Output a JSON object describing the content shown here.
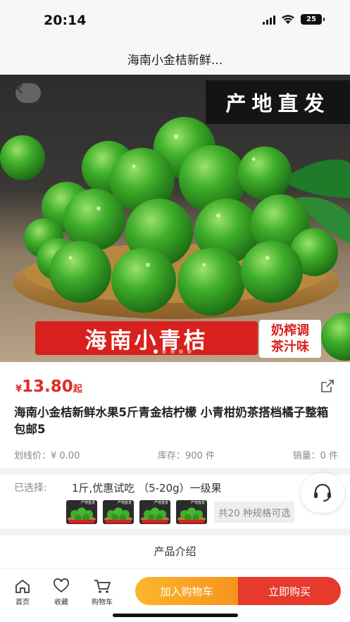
{
  "status_bar": {
    "time": "20:14",
    "battery": "25"
  },
  "nav": {
    "title": "海南小金桔新鲜..."
  },
  "hero": {
    "origin_badge": "产地直发",
    "banner_text": "海南小青桔",
    "banner_side_line1": "奶榨调",
    "banner_side_line2": "茶汁味",
    "slide_count": 5,
    "active_slide": 1
  },
  "product": {
    "currency": "¥",
    "price": "13.80",
    "price_suffix": "起",
    "title": "海南小金桔新鲜水果5斤青金桔柠檬 小青柑奶茶搭档橘子整箱包邮5",
    "list_price": "划线价：¥ 0.00",
    "stock": "库存：900 件",
    "sales": "销量：0 件"
  },
  "spec": {
    "label": "已选择:",
    "value": "1斤,优惠试吃 （5-20g）一级果",
    "thumb_caption": "产地直发",
    "more": "共20 种规格可选"
  },
  "intro": {
    "title": "产品介绍"
  },
  "tab_bar": {
    "home": "首页",
    "favorite": "收藏",
    "cart": "购物车",
    "add_to_cart": "加入购物车",
    "buy_now": "立即购买"
  },
  "colors": {
    "accent_red": "#e02a26",
    "cart_orange": "#f7931e",
    "buy_red": "#e63a2c"
  }
}
